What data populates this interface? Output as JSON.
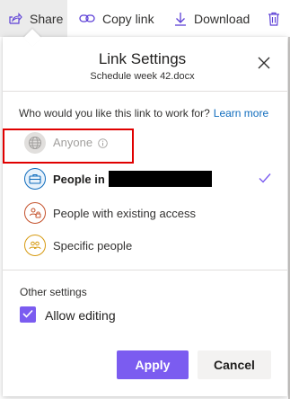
{
  "toolbar": {
    "share_label": "Share",
    "copy_link_label": "Copy link",
    "download_label": "Download"
  },
  "dialog": {
    "title": "Link Settings",
    "file_name": "Schedule week 42.docx",
    "question": "Who would you like this link to work for?",
    "learn_more": "Learn more",
    "options": [
      {
        "label": "Anyone",
        "icon": "globe-icon",
        "state": "disabled"
      },
      {
        "label": "People in",
        "icon": "organization-icon",
        "state": "selected"
      },
      {
        "label": "People with existing access",
        "icon": "people-existing-icon",
        "state": "normal"
      },
      {
        "label": "Specific people",
        "icon": "specific-people-icon",
        "state": "normal"
      }
    ],
    "other_settings_label": "Other settings",
    "allow_editing_label": "Allow editing",
    "allow_editing_checked": true,
    "apply_label": "Apply",
    "cancel_label": "Cancel"
  },
  "colors": {
    "accent": "#7b5cf0",
    "link": "#0f6cbd",
    "annotation_red": "#e00000"
  }
}
